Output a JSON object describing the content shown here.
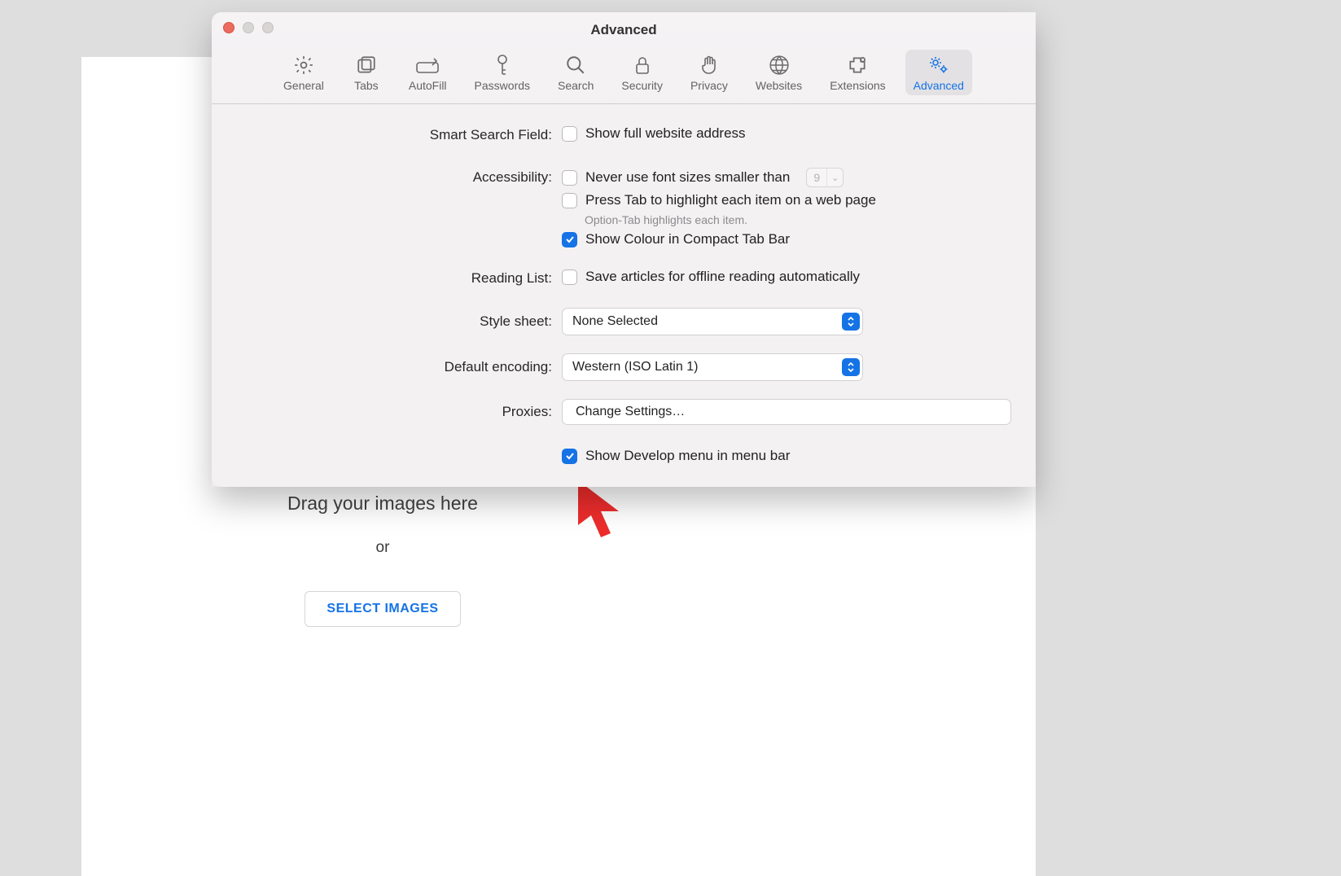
{
  "window_title": "Advanced",
  "toolbar": {
    "general": "General",
    "tabs": "Tabs",
    "autofill": "AutoFill",
    "passwords": "Passwords",
    "search": "Search",
    "security": "Security",
    "privacy": "Privacy",
    "websites": "Websites",
    "extensions": "Extensions",
    "advanced": "Advanced"
  },
  "labels": {
    "smart_search": "Smart Search Field:",
    "accessibility": "Accessibility:",
    "reading_list": "Reading List:",
    "style_sheet": "Style sheet:",
    "default_encoding": "Default encoding:",
    "proxies": "Proxies:"
  },
  "options": {
    "show_full_address": "Show full website address",
    "never_font_smaller": "Never use font sizes smaller than",
    "font_size_value": "9",
    "press_tab": "Press Tab to highlight each item on a web page",
    "press_tab_hint": "Option-Tab highlights each item.",
    "show_colour_tab": "Show Colour in Compact Tab Bar",
    "save_offline": "Save articles for offline reading automatically",
    "style_sheet_value": "None Selected",
    "encoding_value": "Western (ISO Latin 1)",
    "proxies_button": "Change Settings…",
    "show_develop": "Show Develop menu in menu bar"
  },
  "background": {
    "drag_text": "Drag your images here",
    "or": "or",
    "select_button": "SELECT IMAGES"
  }
}
